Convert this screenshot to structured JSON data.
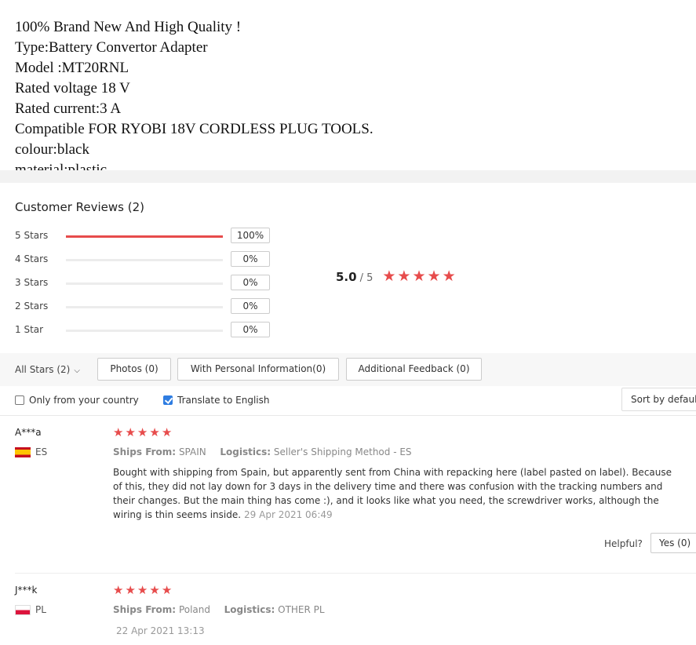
{
  "description": {
    "lines": [
      "100% Brand New And High Quality !",
      "Type:Battery Convertor Adapter",
      "Model :MT20RNL",
      "Rated voltage 18 V",
      "Rated current:3 A",
      "Compatible FOR RYOBI 18V CORDLESS PLUG TOOLS.",
      "colour:black",
      "material:plastic"
    ]
  },
  "reviews": {
    "title": "Customer Reviews (2)",
    "distribution": [
      {
        "label": "5 Stars",
        "percent": 100,
        "percent_text": "100%"
      },
      {
        "label": "4 Stars",
        "percent": 0,
        "percent_text": "0%"
      },
      {
        "label": "3 Stars",
        "percent": 0,
        "percent_text": "0%"
      },
      {
        "label": "2 Stars",
        "percent": 0,
        "percent_text": "0%"
      },
      {
        "label": "1 Star",
        "percent": 0,
        "percent_text": "0%"
      }
    ],
    "average": {
      "score": "5.0",
      "out_of": "/ 5",
      "stars": 5
    },
    "filters": {
      "all_stars": "All Stars (2)",
      "photos": "Photos (0)",
      "personal_info": "With Personal Information(0)",
      "additional_feedback": "Additional Feedback (0)"
    },
    "options": {
      "only_country": {
        "label": "Only from your country",
        "checked": false
      },
      "translate": {
        "label": "Translate to English",
        "checked": true
      },
      "sort": "Sort by default"
    },
    "items": [
      {
        "user": "A***a",
        "country": "ES",
        "stars": 5,
        "ships_from_label": "Ships From:",
        "ships_from": "SPAIN",
        "logistics_label": "Logistics:",
        "logistics": "Seller's Shipping Method - ES",
        "text": "Bought with shipping from Spain, but apparently sent from China with repacking here (label pasted on label). Because of this, they did not lay down for 3 days in the delivery time and there was confusion with the tracking numbers and their changes. But the main thing has come :), and it looks like what you need, the screwdriver works, although the wiring is thin seems inside.",
        "date": "29 Apr 2021 06:49",
        "helpful_label": "Helpful?",
        "yes_label": "Yes (0)"
      },
      {
        "user": "J***k",
        "country": "PL",
        "stars": 5,
        "ships_from_label": "Ships From:",
        "ships_from": "Poland",
        "logistics_label": "Logistics:",
        "logistics": "OTHER PL",
        "text": "",
        "date": "22 Apr 2021 13:13"
      }
    ]
  },
  "colors": {
    "accent": "#e74c4c",
    "checkbox": "#2f7de1"
  },
  "icons": {
    "star": "star-icon",
    "chevron": "chevron-down-icon",
    "flag_es": "flag-es-icon",
    "flag_pl": "flag-pl-icon"
  }
}
